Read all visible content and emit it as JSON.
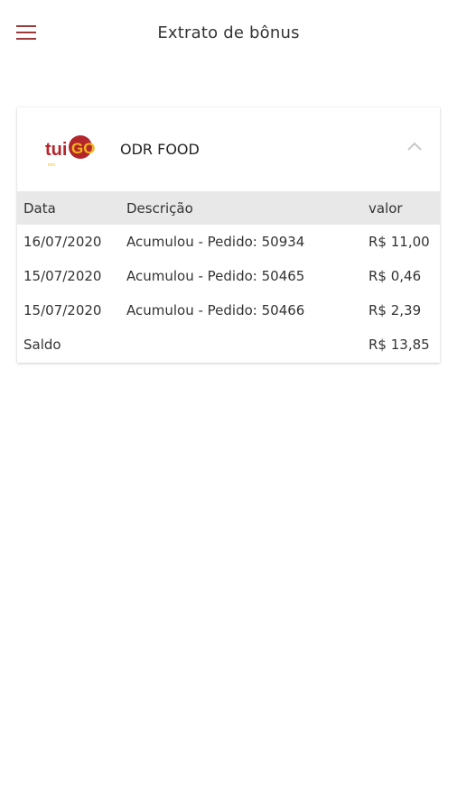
{
  "header": {
    "title": "Extrato de bônus",
    "menu_icon": "menu-icon"
  },
  "store": {
    "logo_text": "tuiGO",
    "name": "ODR FOOD",
    "expand_icon": "chevron-up-icon"
  },
  "table": {
    "columns": [
      "Data",
      "Descrição",
      "valor"
    ],
    "rows": [
      {
        "date": "16/07/2020",
        "description": "Acumulou - Pedido: 50934",
        "value": "R$ 11,00"
      },
      {
        "date": "15/07/2020",
        "description": "Acumulou - Pedido: 50465",
        "value": "R$ 0,46"
      },
      {
        "date": "15/07/2020",
        "description": "Acumulou - Pedido: 50466",
        "value": "R$ 2,39"
      }
    ],
    "balance_label": "Saldo",
    "balance_value": "R$ 13,85"
  },
  "colors": {
    "accent": "#9b3a3a",
    "logo_red": "#b3262b",
    "logo_yellow": "#f2b51c",
    "header_row_bg": "#e8e8e8"
  }
}
